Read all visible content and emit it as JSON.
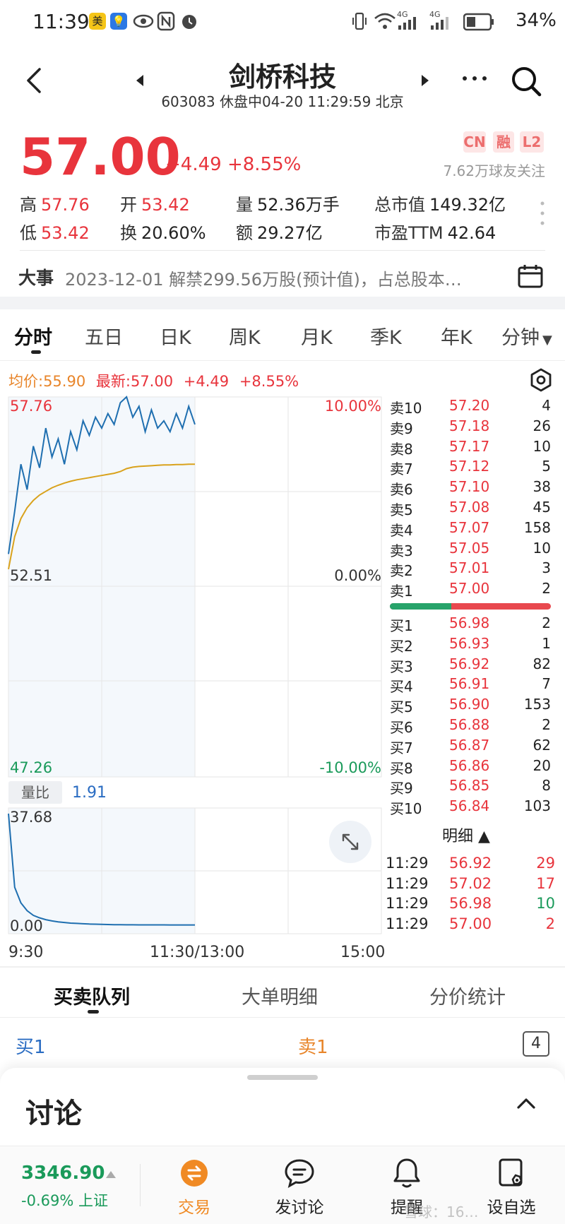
{
  "status_bar": {
    "time": "11:39",
    "badge_mei": "美",
    "network_4g_1": "4G",
    "network_4g_2": "4G",
    "battery": "34%"
  },
  "header": {
    "name": "剑桥科技",
    "subtitle": "603083 休盘中04-20 11:29:59 北京"
  },
  "quote": {
    "price": "57.00",
    "change": "+4.49 +8.55%",
    "tags": [
      "CN",
      "融",
      "L2"
    ],
    "followers": "7.62万球友关注",
    "stats": {
      "high_label": "高",
      "high": "57.76",
      "open_label": "开",
      "open": "53.42",
      "volume_label": "量",
      "volume": "52.36万手",
      "mktcap_label": "总市值",
      "mktcap": "149.32亿",
      "low_label": "低",
      "low": "53.42",
      "turnover_label": "换",
      "turnover": "20.60%",
      "amount_label": "额",
      "amount": "29.27亿",
      "pe_label": "市盈TTM",
      "pe": "42.64"
    }
  },
  "event": {
    "label": "大事",
    "text": "2023-12-01 解禁299.56万股(预计值)，占总股本…"
  },
  "chart_tabs": [
    "分时",
    "五日",
    "日K",
    "周K",
    "月K",
    "季K",
    "年K",
    "分钟"
  ],
  "chart_header": {
    "avg_label": "均价:55.90",
    "latest_label": "最新:57.00",
    "change": "+4.49",
    "pct": "+8.55%"
  },
  "chart_data": {
    "type": "line",
    "title": "",
    "y_left_ticks": [
      "57.76",
      "52.51",
      "47.26"
    ],
    "y_right_ticks": [
      "10.00%",
      "0.00%",
      "-10.00%"
    ],
    "ylim": [
      47.26,
      57.76
    ],
    "x_ticks": [
      "9:30",
      "11:30/13:00",
      "15:00"
    ],
    "x": [
      0,
      4,
      8,
      12,
      16,
      20,
      24,
      28,
      32,
      36,
      40,
      44,
      48,
      52,
      56,
      60,
      64,
      68,
      72,
      76,
      80,
      84,
      88,
      92,
      96,
      100,
      104,
      108,
      112,
      116,
      120
    ],
    "series": [
      {
        "values": [
          53.42,
          54.6,
          55.9,
          55.2,
          56.4,
          55.8,
          56.9,
          56.1,
          56.6,
          55.9,
          56.8,
          56.3,
          57.1,
          56.7,
          57.2,
          56.9,
          57.3,
          57.0,
          57.6,
          57.76,
          57.2,
          57.5,
          56.8,
          57.4,
          56.9,
          57.1,
          56.8,
          57.3,
          56.9,
          57.5,
          57.0
        ]
      },
      {
        "values": [
          53.0,
          53.9,
          54.4,
          54.7,
          54.9,
          55.05,
          55.15,
          55.25,
          55.32,
          55.38,
          55.43,
          55.47,
          55.5,
          55.53,
          55.56,
          55.59,
          55.62,
          55.65,
          55.7,
          55.78,
          55.82,
          55.84,
          55.85,
          55.86,
          55.87,
          55.88,
          55.88,
          55.89,
          55.89,
          55.9,
          55.9
        ]
      }
    ],
    "volume_ratio": {
      "label": "量比",
      "value": "1.91",
      "ylim_labels": [
        "37.68",
        "0.00"
      ],
      "ylim": [
        0,
        37.68
      ],
      "values": [
        37.68,
        14.0,
        9.0,
        6.5,
        5.0,
        4.2,
        3.6,
        3.2,
        2.9,
        2.7,
        2.5,
        2.4,
        2.3,
        2.2,
        2.15,
        2.1,
        2.05,
        2.0,
        1.98,
        1.96,
        1.95,
        1.94,
        1.93,
        1.93,
        1.92,
        1.92,
        1.91,
        1.91,
        1.91,
        1.91,
        1.91
      ]
    }
  },
  "order_book": {
    "asks": [
      {
        "name": "卖10",
        "price": "57.20",
        "vol": "4"
      },
      {
        "name": "卖9",
        "price": "57.18",
        "vol": "26"
      },
      {
        "name": "卖8",
        "price": "57.17",
        "vol": "10"
      },
      {
        "name": "卖7",
        "price": "57.12",
        "vol": "5"
      },
      {
        "name": "卖6",
        "price": "57.10",
        "vol": "38"
      },
      {
        "name": "卖5",
        "price": "57.08",
        "vol": "45"
      },
      {
        "name": "卖4",
        "price": "57.07",
        "vol": "158"
      },
      {
        "name": "卖3",
        "price": "57.05",
        "vol": "10"
      },
      {
        "name": "卖2",
        "price": "57.01",
        "vol": "3"
      },
      {
        "name": "卖1",
        "price": "57.00",
        "vol": "2"
      }
    ],
    "bids": [
      {
        "name": "买1",
        "price": "56.98",
        "vol": "2"
      },
      {
        "name": "买2",
        "price": "56.93",
        "vol": "1"
      },
      {
        "name": "买3",
        "price": "56.92",
        "vol": "82"
      },
      {
        "name": "买4",
        "price": "56.91",
        "vol": "7"
      },
      {
        "name": "买5",
        "price": "56.90",
        "vol": "153"
      },
      {
        "name": "买6",
        "price": "56.88",
        "vol": "2"
      },
      {
        "name": "买7",
        "price": "56.87",
        "vol": "62"
      },
      {
        "name": "买8",
        "price": "56.86",
        "vol": "20"
      },
      {
        "name": "买9",
        "price": "56.85",
        "vol": "8"
      },
      {
        "name": "买10",
        "price": "56.84",
        "vol": "103"
      }
    ],
    "buy_ratio": 0.38
  },
  "detail": {
    "header": "明细 ▲",
    "ticks": [
      {
        "time": "11:29",
        "price": "56.92",
        "vol": "29",
        "color": "#e8343c"
      },
      {
        "time": "11:29",
        "price": "57.02",
        "vol": "17",
        "color": "#e8343c"
      },
      {
        "time": "11:29",
        "price": "56.98",
        "vol": "10",
        "color": "#1a9a5a"
      },
      {
        "time": "11:29",
        "price": "57.00",
        "vol": "2",
        "color": "#e8343c"
      }
    ]
  },
  "bottom_tabs": [
    "买卖队列",
    "大单明细",
    "分价统计"
  ],
  "queue": {
    "buy": "买1",
    "sell": "卖1",
    "count": "4"
  },
  "discussion": {
    "title": "讨论"
  },
  "bottom_nav": {
    "index_value": "3346.90",
    "index_change": "-0.69% 上证",
    "trade": "交易",
    "post": "发讨论",
    "remind": "提醒",
    "watch": "设自选"
  },
  "watermark": "雪球：16…",
  "colors": {
    "up": "#e8343c",
    "down": "#1a9a5a",
    "line": "#1f6fb0",
    "avg": "#d9a21c"
  }
}
